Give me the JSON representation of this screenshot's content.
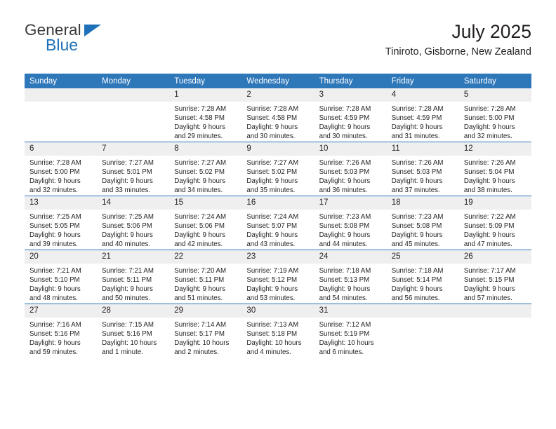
{
  "brand": {
    "name_part1": "General",
    "name_part2": "Blue",
    "triangle_icon": "triangle-icon",
    "accent_color": "#1e70b8"
  },
  "header": {
    "title": "July 2025",
    "subtitle": "Tiniroto, Gisborne, New Zealand"
  },
  "theme": {
    "header_band_color": "#2e77b9",
    "daynum_band_color": "#efefef",
    "text_color": "#231f20"
  },
  "weekdays": [
    "Sunday",
    "Monday",
    "Tuesday",
    "Wednesday",
    "Thursday",
    "Friday",
    "Saturday"
  ],
  "weeks": [
    [
      {
        "day": "",
        "empty": true
      },
      {
        "day": "",
        "empty": true
      },
      {
        "day": "1",
        "sunrise": "Sunrise: 7:28 AM",
        "sunset": "Sunset: 4:58 PM",
        "daylight": "Daylight: 9 hours and 29 minutes."
      },
      {
        "day": "2",
        "sunrise": "Sunrise: 7:28 AM",
        "sunset": "Sunset: 4:58 PM",
        "daylight": "Daylight: 9 hours and 30 minutes."
      },
      {
        "day": "3",
        "sunrise": "Sunrise: 7:28 AM",
        "sunset": "Sunset: 4:59 PM",
        "daylight": "Daylight: 9 hours and 30 minutes."
      },
      {
        "day": "4",
        "sunrise": "Sunrise: 7:28 AM",
        "sunset": "Sunset: 4:59 PM",
        "daylight": "Daylight: 9 hours and 31 minutes."
      },
      {
        "day": "5",
        "sunrise": "Sunrise: 7:28 AM",
        "sunset": "Sunset: 5:00 PM",
        "daylight": "Daylight: 9 hours and 32 minutes."
      }
    ],
    [
      {
        "day": "6",
        "sunrise": "Sunrise: 7:28 AM",
        "sunset": "Sunset: 5:00 PM",
        "daylight": "Daylight: 9 hours and 32 minutes."
      },
      {
        "day": "7",
        "sunrise": "Sunrise: 7:27 AM",
        "sunset": "Sunset: 5:01 PM",
        "daylight": "Daylight: 9 hours and 33 minutes."
      },
      {
        "day": "8",
        "sunrise": "Sunrise: 7:27 AM",
        "sunset": "Sunset: 5:02 PM",
        "daylight": "Daylight: 9 hours and 34 minutes."
      },
      {
        "day": "9",
        "sunrise": "Sunrise: 7:27 AM",
        "sunset": "Sunset: 5:02 PM",
        "daylight": "Daylight: 9 hours and 35 minutes."
      },
      {
        "day": "10",
        "sunrise": "Sunrise: 7:26 AM",
        "sunset": "Sunset: 5:03 PM",
        "daylight": "Daylight: 9 hours and 36 minutes."
      },
      {
        "day": "11",
        "sunrise": "Sunrise: 7:26 AM",
        "sunset": "Sunset: 5:03 PM",
        "daylight": "Daylight: 9 hours and 37 minutes."
      },
      {
        "day": "12",
        "sunrise": "Sunrise: 7:26 AM",
        "sunset": "Sunset: 5:04 PM",
        "daylight": "Daylight: 9 hours and 38 minutes."
      }
    ],
    [
      {
        "day": "13",
        "sunrise": "Sunrise: 7:25 AM",
        "sunset": "Sunset: 5:05 PM",
        "daylight": "Daylight: 9 hours and 39 minutes."
      },
      {
        "day": "14",
        "sunrise": "Sunrise: 7:25 AM",
        "sunset": "Sunset: 5:06 PM",
        "daylight": "Daylight: 9 hours and 40 minutes."
      },
      {
        "day": "15",
        "sunrise": "Sunrise: 7:24 AM",
        "sunset": "Sunset: 5:06 PM",
        "daylight": "Daylight: 9 hours and 42 minutes."
      },
      {
        "day": "16",
        "sunrise": "Sunrise: 7:24 AM",
        "sunset": "Sunset: 5:07 PM",
        "daylight": "Daylight: 9 hours and 43 minutes."
      },
      {
        "day": "17",
        "sunrise": "Sunrise: 7:23 AM",
        "sunset": "Sunset: 5:08 PM",
        "daylight": "Daylight: 9 hours and 44 minutes."
      },
      {
        "day": "18",
        "sunrise": "Sunrise: 7:23 AM",
        "sunset": "Sunset: 5:08 PM",
        "daylight": "Daylight: 9 hours and 45 minutes."
      },
      {
        "day": "19",
        "sunrise": "Sunrise: 7:22 AM",
        "sunset": "Sunset: 5:09 PM",
        "daylight": "Daylight: 9 hours and 47 minutes."
      }
    ],
    [
      {
        "day": "20",
        "sunrise": "Sunrise: 7:21 AM",
        "sunset": "Sunset: 5:10 PM",
        "daylight": "Daylight: 9 hours and 48 minutes."
      },
      {
        "day": "21",
        "sunrise": "Sunrise: 7:21 AM",
        "sunset": "Sunset: 5:11 PM",
        "daylight": "Daylight: 9 hours and 50 minutes."
      },
      {
        "day": "22",
        "sunrise": "Sunrise: 7:20 AM",
        "sunset": "Sunset: 5:11 PM",
        "daylight": "Daylight: 9 hours and 51 minutes."
      },
      {
        "day": "23",
        "sunrise": "Sunrise: 7:19 AM",
        "sunset": "Sunset: 5:12 PM",
        "daylight": "Daylight: 9 hours and 53 minutes."
      },
      {
        "day": "24",
        "sunrise": "Sunrise: 7:18 AM",
        "sunset": "Sunset: 5:13 PM",
        "daylight": "Daylight: 9 hours and 54 minutes."
      },
      {
        "day": "25",
        "sunrise": "Sunrise: 7:18 AM",
        "sunset": "Sunset: 5:14 PM",
        "daylight": "Daylight: 9 hours and 56 minutes."
      },
      {
        "day": "26",
        "sunrise": "Sunrise: 7:17 AM",
        "sunset": "Sunset: 5:15 PM",
        "daylight": "Daylight: 9 hours and 57 minutes."
      }
    ],
    [
      {
        "day": "27",
        "sunrise": "Sunrise: 7:16 AM",
        "sunset": "Sunset: 5:16 PM",
        "daylight": "Daylight: 9 hours and 59 minutes."
      },
      {
        "day": "28",
        "sunrise": "Sunrise: 7:15 AM",
        "sunset": "Sunset: 5:16 PM",
        "daylight": "Daylight: 10 hours and 1 minute."
      },
      {
        "day": "29",
        "sunrise": "Sunrise: 7:14 AM",
        "sunset": "Sunset: 5:17 PM",
        "daylight": "Daylight: 10 hours and 2 minutes."
      },
      {
        "day": "30",
        "sunrise": "Sunrise: 7:13 AM",
        "sunset": "Sunset: 5:18 PM",
        "daylight": "Daylight: 10 hours and 4 minutes."
      },
      {
        "day": "31",
        "sunrise": "Sunrise: 7:12 AM",
        "sunset": "Sunset: 5:19 PM",
        "daylight": "Daylight: 10 hours and 6 minutes."
      },
      {
        "day": "",
        "empty": true
      },
      {
        "day": "",
        "empty": true
      }
    ]
  ]
}
